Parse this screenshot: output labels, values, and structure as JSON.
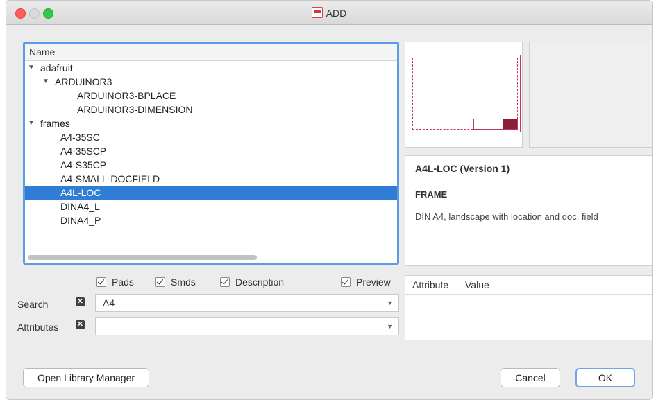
{
  "window": {
    "title": "ADD",
    "icon": "eagle-add-icon"
  },
  "tree": {
    "header": "Name",
    "rows": [
      {
        "label": "adafruit",
        "level": 0,
        "expanded": true,
        "selected": false
      },
      {
        "label": "ARDUINOR3",
        "level": 1,
        "expanded": true,
        "selected": false
      },
      {
        "label": "ARDUINOR3-BPLACE",
        "level": 2,
        "selected": false
      },
      {
        "label": "ARDUINOR3-DIMENSION",
        "level": 2,
        "selected": false
      },
      {
        "label": "frames",
        "level": 0,
        "expanded": true,
        "selected": false
      },
      {
        "label": "A4-35SC",
        "level": 1,
        "selected": false
      },
      {
        "label": "A4-35SCP",
        "level": 1,
        "selected": false
      },
      {
        "label": "A4-S35CP",
        "level": 1,
        "selected": false
      },
      {
        "label": "A4-SMALL-DOCFIELD",
        "level": 1,
        "selected": false
      },
      {
        "label": "A4L-LOC",
        "level": 1,
        "selected": true
      },
      {
        "label": "DINA4_L",
        "level": 1,
        "selected": false
      },
      {
        "label": "DINA4_P",
        "level": 1,
        "selected": false
      }
    ]
  },
  "description": {
    "title": "A4L-LOC (Version 1)",
    "type": "FRAME",
    "text": "DIN A4, landscape with location and doc. field"
  },
  "options": {
    "pads": "Pads",
    "smds": "Smds",
    "description": "Description",
    "preview": "Preview"
  },
  "search": {
    "label": "Search",
    "value": "A4"
  },
  "attributes": {
    "label": "Attributes",
    "value": ""
  },
  "attr_table": {
    "col_attribute": "Attribute",
    "col_value": "Value"
  },
  "buttons": {
    "library_manager": "Open Library Manager",
    "cancel": "Cancel",
    "ok": "OK"
  },
  "colors": {
    "selection": "#2f7dd5",
    "focus_ring": "#5b9ae8",
    "frame_line": "#c0365a"
  }
}
